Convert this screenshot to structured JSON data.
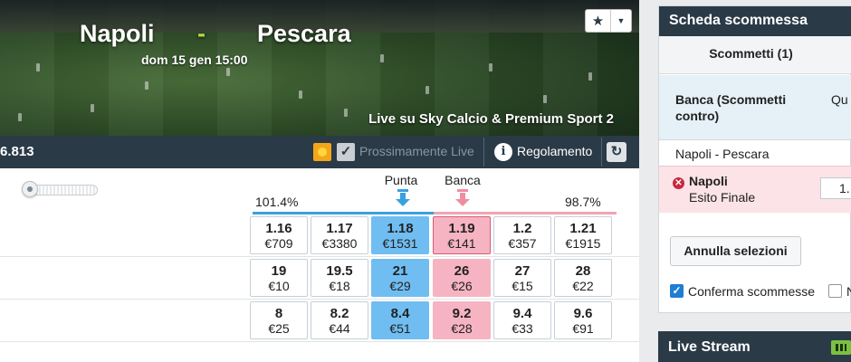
{
  "event": {
    "home_team": "Napoli",
    "separator": "-",
    "away_team": "Pescara",
    "date": "dom 15 gen 15:00",
    "broadcast": "Live su Sky Calcio & Premium Sport 2"
  },
  "toolbar": {
    "matched_amount": "6.813",
    "soon_live_label": "Prossimamente Live",
    "rules_label": "Regolamento"
  },
  "market": {
    "back_overround": "101.4%",
    "lay_overround": "98.7%",
    "back_header": "Punta",
    "lay_header": "Banca",
    "runners": [
      {
        "back": [
          {
            "price": "1.16",
            "size": "€709"
          },
          {
            "price": "1.17",
            "size": "€3380"
          },
          {
            "price": "1.18",
            "size": "€1531"
          }
        ],
        "lay": [
          {
            "price": "1.19",
            "size": "€141"
          },
          {
            "price": "1.2",
            "size": "€357"
          },
          {
            "price": "1.21",
            "size": "€1915"
          }
        ]
      },
      {
        "back": [
          {
            "price": "19",
            "size": "€10"
          },
          {
            "price": "19.5",
            "size": "€18"
          },
          {
            "price": "21",
            "size": "€29"
          }
        ],
        "lay": [
          {
            "price": "26",
            "size": "€26"
          },
          {
            "price": "27",
            "size": "€15"
          },
          {
            "price": "28",
            "size": "€22"
          }
        ]
      },
      {
        "back": [
          {
            "price": "8",
            "size": "€25"
          },
          {
            "price": "8.2",
            "size": "€44"
          },
          {
            "price": "8.4",
            "size": "€51"
          }
        ],
        "lay": [
          {
            "price": "9.2",
            "size": "€28"
          },
          {
            "price": "9.4",
            "size": "€33"
          },
          {
            "price": "9.6",
            "size": "€91"
          }
        ]
      }
    ]
  },
  "betslip": {
    "title": "Scheda scommessa",
    "bets_tab": "Scommetti (1)",
    "lay_section_title": "Banca (Scommetti contro)",
    "odds_column_head": "Qu scomm",
    "event_name": "Napoli - Pescara",
    "selection": {
      "name": "Napoli",
      "market": "Esito Finale",
      "odds": "1."
    },
    "cancel_label": "Annulla selezioni",
    "confirm_label": "Conferma scommesse",
    "other_option_label": "N",
    "confirm_checked": true
  },
  "livestream": {
    "title": "Live Stream"
  },
  "colors": {
    "header_dark": "#2b3a47",
    "back_best": "#70bdf2",
    "lay_best": "#f6b4c2",
    "back_line": "#3aa0e0",
    "lay_line": "#f2a3b2",
    "selection_bg": "#fbe3e7"
  },
  "icons": [
    "star-icon",
    "chevron-down-icon",
    "live-icon",
    "check-icon",
    "info-icon",
    "refresh-icon",
    "arrow-down-icon",
    "close-icon",
    "checkbox-icon",
    "stream-icon"
  ]
}
